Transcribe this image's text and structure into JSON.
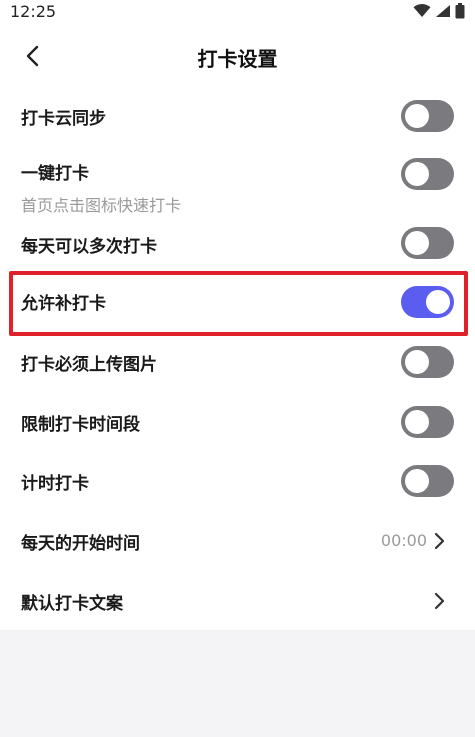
{
  "status_bar": {
    "time": "12:25",
    "icons": [
      "wifi-icon",
      "signal-icon",
      "battery-icon"
    ]
  },
  "header": {
    "title": "打卡设置",
    "back_icon": "chevron-left-icon"
  },
  "settings": [
    {
      "label": "打卡云同步",
      "type": "toggle",
      "on": false
    },
    {
      "label": "一键打卡",
      "sublabel": "首页点击图标快速打卡",
      "type": "toggle",
      "on": false
    },
    {
      "label": "每天可以多次打卡",
      "type": "toggle",
      "on": false
    },
    {
      "label": "允许补打卡",
      "type": "toggle",
      "on": true
    },
    {
      "label": "打卡必须上传图片",
      "type": "toggle",
      "on": false
    },
    {
      "label": "限制打卡时间段",
      "type": "toggle",
      "on": false
    },
    {
      "label": "计时打卡",
      "type": "toggle",
      "on": false
    },
    {
      "label": "每天的开始时间",
      "type": "link",
      "value": "00:00"
    },
    {
      "label": "默认打卡文案",
      "type": "link"
    }
  ],
  "colors": {
    "toggle_on": "#5b5cf0",
    "toggle_off": "#7b7b7f",
    "highlight": "#e0202a"
  }
}
